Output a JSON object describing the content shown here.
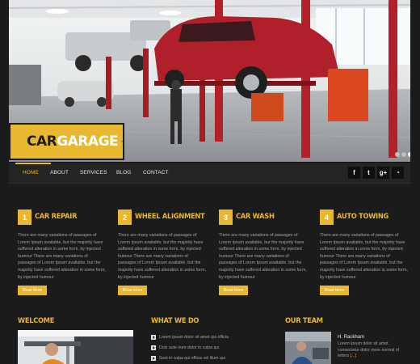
{
  "brand": {
    "word1": "CAR",
    "word2": "GARAGE",
    "accent": "#e8b830"
  },
  "nav": {
    "items": [
      "HOME",
      "ABOUT",
      "SERVICES",
      "BLOG",
      "CONTACT"
    ],
    "active": "HOME",
    "social": [
      {
        "icon": "facebook-icon",
        "glyph": "f"
      },
      {
        "icon": "twitter-icon",
        "glyph": "t"
      },
      {
        "icon": "googleplus-icon",
        "glyph": "g+"
      },
      {
        "icon": "rss-icon",
        "glyph": "◔"
      }
    ]
  },
  "slider": {
    "slides": 4,
    "active": 3
  },
  "services": [
    {
      "num": "1",
      "title": "CAR REPAIR",
      "text": "There are many variations of passages of Lorem Ipsum available, but the majority have suffered alteration in some form, by injected humour There are many variations of passages of Lorem Ipsum available, but the majority have suffered alteration in some form, by injected humour",
      "button": "Read More"
    },
    {
      "num": "2",
      "title": "WHEEL ALIGNMENT",
      "text": "There are many variations of passages of Lorem Ipsum available, but the majority have suffered alteration in some form, by injected humour There are many variations of passages of Lorem Ipsum available, but the majority have suffered alteration in some form, by injected humour",
      "button": "Read More"
    },
    {
      "num": "3",
      "title": "CAR WASH",
      "text": "There are many variations of passages of Lorem Ipsum available, but the majority have suffered alteration in some form, by injected humour There are many variations of passages of Lorem Ipsum available, but the majority have suffered alteration in some form, by injected humour",
      "button": "Read More"
    },
    {
      "num": "4",
      "title": "AUTO TOWING",
      "text": "There are many variations of passages of Lorem Ipsum available, but the majority have suffered alteration in some form, by injected humour There are many variations of passages of Lorem Ipsum available, but the majority have suffered alteration in some form, by injected humour",
      "button": "Read More"
    }
  ],
  "welcome": {
    "title": "WELCOME"
  },
  "what_we_do": {
    "title": "WHAT WE DO",
    "items": [
      "Lorem ipsum dolor sit amet qui officia",
      "Duis aute irure dolor in culpa qui",
      "Sunt in culpa qui officia vel illum qui"
    ]
  },
  "team": {
    "title": "OUR TEAM",
    "member_name": "H. Rackham",
    "member_text": "Lorem ipsum dolor sit amet consectetur dolor more normal of letters",
    "more": "[...]"
  }
}
